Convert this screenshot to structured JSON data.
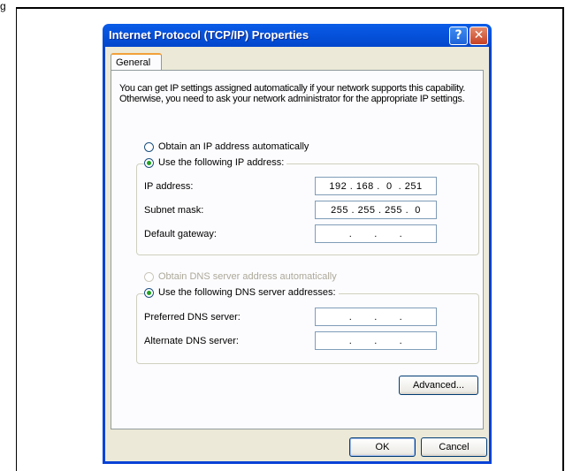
{
  "page_label": "g",
  "window": {
    "title": "Internet Protocol (TCP/IP) Properties",
    "help_label": "?",
    "close_label": "✕"
  },
  "tabs": [
    {
      "label": "General",
      "selected": true
    }
  ],
  "description": "You can get IP settings assigned automatically if your network supports this capability. Otherwise, you need to ask your network administrator for the appropriate IP settings.",
  "ip_section": {
    "obtain_auto": {
      "label": "Obtain an IP address automatically",
      "checked": false
    },
    "use_following": {
      "label": "Use the following IP address:",
      "checked": true
    },
    "fields": [
      {
        "label": "IP address:",
        "value": "192 . 168 .  0  . 251"
      },
      {
        "label": "Subnet mask:",
        "value": "255 . 255 . 255 .  0"
      },
      {
        "label": "Default gateway:",
        "value": ".       .       ."
      }
    ]
  },
  "dns_section": {
    "obtain_auto": {
      "label": "Obtain DNS server address automatically",
      "checked": false,
      "disabled": true
    },
    "use_following": {
      "label": "Use the following DNS server addresses:",
      "checked": true
    },
    "fields": [
      {
        "label": "Preferred DNS server:",
        "value": ".       .       ."
      },
      {
        "label": "Alternate DNS server:",
        "value": ".       .       ."
      }
    ]
  },
  "buttons": {
    "advanced": "Advanced...",
    "ok": "OK",
    "cancel": "Cancel"
  },
  "colors": {
    "titlebar": "#0a5ce8",
    "dialog_bg": "#ece9d8",
    "tab_accent": "#f2a03a",
    "radio_dot": "#21a121",
    "close_button": "#c74125"
  }
}
